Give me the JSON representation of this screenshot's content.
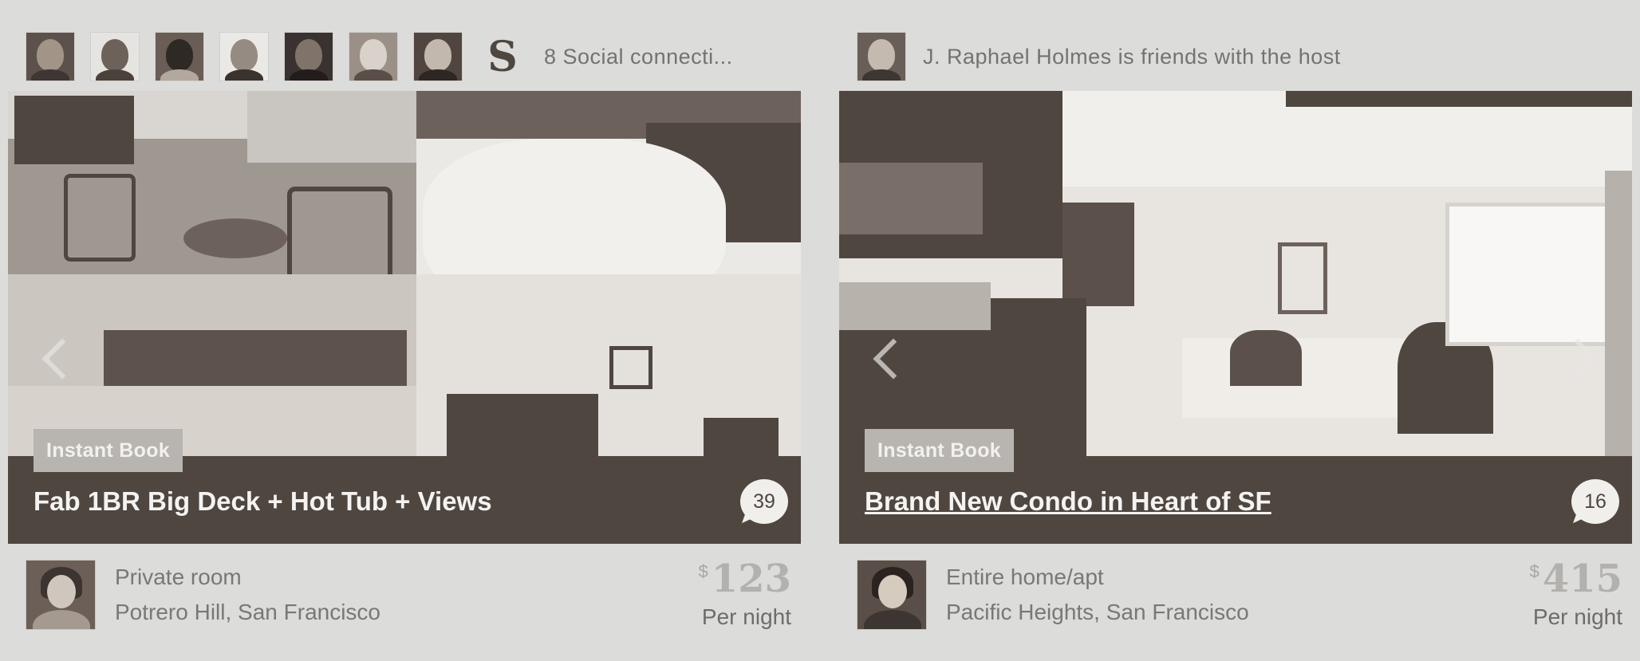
{
  "listings": [
    {
      "social": {
        "avatars": [
          "friend-1",
          "friend-2",
          "friend-3",
          "friend-4",
          "friend-5",
          "friend-6",
          "friend-7"
        ],
        "school_icon": "stanford-s-icon",
        "school_letter": "S",
        "text": "8 Social connecti..."
      },
      "badge": "Instant Book",
      "title": "Fab 1BR Big Deck + Hot Tub + Views",
      "reviews": "39",
      "room_type": "Private room",
      "location": "Potrero Hill, San Francisco",
      "currency": "$",
      "price": "123",
      "per_night": "Per night"
    },
    {
      "social": {
        "avatars": [
          "friend-1"
        ],
        "text": "J. Raphael Holmes is friends with the host"
      },
      "badge": "Instant Book",
      "title": "Brand New Condo in Heart of SF",
      "reviews": "16",
      "room_type": "Entire home/apt",
      "location": "Pacific Heights, San Francisco",
      "currency": "$",
      "price": "415",
      "per_night": "Per night"
    }
  ],
  "icons": {
    "prev": "chevron-left-icon",
    "next": "chevron-right-icon",
    "reviews": "speech-bubble-icon"
  },
  "colors": {
    "background": "#dcdcda",
    "photo_dark": "#4f4640",
    "badge_bg": "#b8b5b0",
    "text_muted": "#7a7777",
    "price": "#b3b1ae"
  }
}
